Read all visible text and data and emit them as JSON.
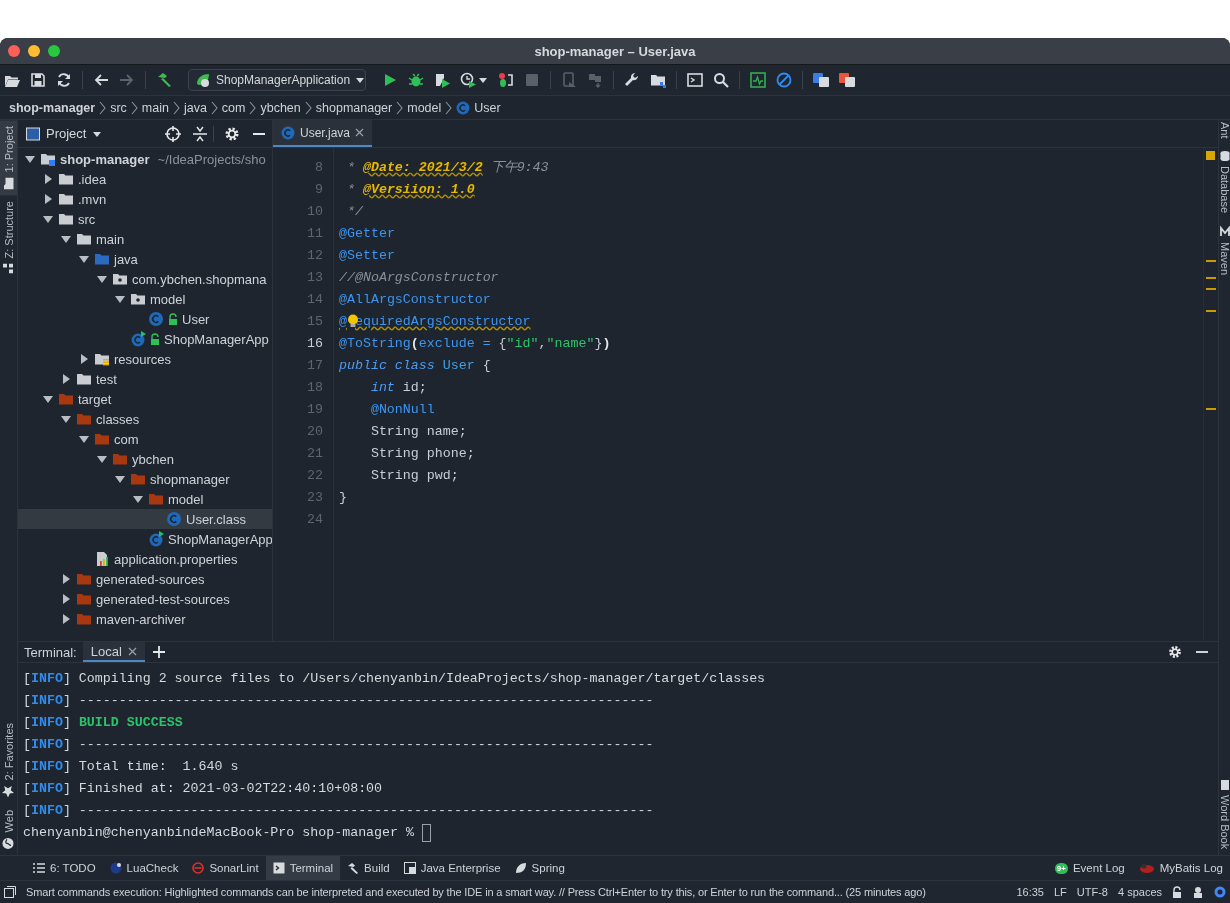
{
  "window": {
    "title": "shop-manager – User.java"
  },
  "toolbar": {
    "run_configuration": "ShopManagerApplication"
  },
  "breadcrumbs": [
    {
      "label": "shop-manager",
      "kind": "project"
    },
    {
      "label": "src",
      "kind": "dir"
    },
    {
      "label": "main",
      "kind": "dir"
    },
    {
      "label": "java",
      "kind": "dir"
    },
    {
      "label": "com",
      "kind": "dir"
    },
    {
      "label": "ybchen",
      "kind": "dir"
    },
    {
      "label": "shopmanager",
      "kind": "dir"
    },
    {
      "label": "model",
      "kind": "dir"
    },
    {
      "label": "User",
      "kind": "class"
    }
  ],
  "left_stripe": {
    "top": [
      {
        "label": "1: Project",
        "kind": "project",
        "selected": true
      },
      {
        "label": "Z: Structure",
        "kind": "structure",
        "selected": false
      }
    ],
    "bottom": [
      {
        "label": "2: Favorites",
        "kind": "favorites",
        "selected": false
      },
      {
        "label": "Web",
        "kind": "web",
        "selected": false
      }
    ]
  },
  "right_stripe": {
    "top": [
      {
        "label": "Ant",
        "kind": "ant"
      },
      {
        "label": "Database",
        "kind": "database"
      },
      {
        "label": "Maven",
        "kind": "maven"
      }
    ],
    "bottom": [
      {
        "label": "Word Book",
        "kind": "book"
      }
    ]
  },
  "project_panel": {
    "title": "Project",
    "tree": [
      {
        "label": "shop-manager",
        "hint": "~/IdeaProjects/sho",
        "kind": "module",
        "expanded": true,
        "selected": false,
        "children": [
          {
            "label": ".idea",
            "kind": "folder",
            "expanded": false,
            "selected": false
          },
          {
            "label": ".mvn",
            "kind": "folder",
            "expanded": false,
            "selected": false
          },
          {
            "label": "src",
            "kind": "folder",
            "expanded": true,
            "selected": false,
            "children": [
              {
                "label": "main",
                "kind": "folder",
                "expanded": true,
                "selected": false,
                "children": [
                  {
                    "label": "java",
                    "kind": "source",
                    "expanded": true,
                    "selected": false,
                    "children": [
                      {
                        "label": "com.ybchen.shopmana",
                        "kind": "package",
                        "expanded": true,
                        "selected": false,
                        "children": [
                          {
                            "label": "model",
                            "kind": "package",
                            "expanded": true,
                            "selected": false,
                            "children": [
                              {
                                "label": "User",
                                "kind": "class",
                                "locked": true,
                                "selected": false
                              }
                            ]
                          },
                          {
                            "label": "ShopManagerApp",
                            "kind": "appclass",
                            "locked": true,
                            "selected": false
                          }
                        ]
                      }
                    ]
                  },
                  {
                    "label": "resources",
                    "kind": "resources",
                    "expanded": false,
                    "selected": false
                  }
                ]
              },
              {
                "label": "test",
                "kind": "folder",
                "expanded": false,
                "selected": false
              }
            ]
          },
          {
            "label": "target",
            "kind": "excluded",
            "expanded": true,
            "selected": false,
            "children": [
              {
                "label": "classes",
                "kind": "excluded",
                "expanded": true,
                "selected": false,
                "children": [
                  {
                    "label": "com",
                    "kind": "excluded",
                    "expanded": true,
                    "selected": false,
                    "children": [
                      {
                        "label": "ybchen",
                        "kind": "excluded",
                        "expanded": true,
                        "selected": false,
                        "children": [
                          {
                            "label": "shopmanager",
                            "kind": "excluded",
                            "expanded": true,
                            "selected": false,
                            "children": [
                              {
                                "label": "model",
                                "kind": "excluded",
                                "expanded": true,
                                "selected": false,
                                "children": [
                                  {
                                    "label": "User.class",
                                    "kind": "class",
                                    "locked": false,
                                    "selected": true
                                  }
                                ]
                              },
                              {
                                "label": "ShopManagerApp",
                                "kind": "appclass",
                                "locked": false,
                                "selected": false
                              }
                            ]
                          }
                        ]
                      }
                    ]
                  },
                  {
                    "label": "application.properties",
                    "kind": "properties",
                    "selected": false
                  }
                ]
              },
              {
                "label": "generated-sources",
                "kind": "excluded",
                "expanded": false,
                "selected": false
              },
              {
                "label": "generated-test-sources",
                "kind": "excluded",
                "expanded": false,
                "selected": false
              },
              {
                "label": "maven-archiver",
                "kind": "excluded",
                "expanded": false,
                "selected": false
              }
            ]
          }
        ]
      }
    ]
  },
  "editor": {
    "tabs": [
      {
        "label": "User.java",
        "selected": true
      }
    ],
    "lines": [
      {
        "number": "8",
        "current": false,
        "bulb": false,
        "tokens": [
          {
            "kind": "comment",
            "text": " * "
          },
          {
            "kind": "doctag",
            "text": "@Date: 2021/3/2"
          },
          {
            "kind": "comment",
            "text": " 下午9:43"
          }
        ]
      },
      {
        "number": "9",
        "current": false,
        "bulb": false,
        "tokens": [
          {
            "kind": "comment",
            "text": " * "
          },
          {
            "kind": "doctag",
            "text": "@Versiion: 1.0"
          }
        ]
      },
      {
        "number": "10",
        "current": false,
        "bulb": false,
        "tokens": [
          {
            "kind": "comment",
            "text": " */"
          }
        ]
      },
      {
        "number": "11",
        "current": false,
        "bulb": false,
        "tokens": [
          {
            "kind": "annotation",
            "text": "@Getter"
          }
        ]
      },
      {
        "number": "12",
        "current": false,
        "bulb": false,
        "tokens": [
          {
            "kind": "annotation",
            "text": "@Setter"
          }
        ]
      },
      {
        "number": "13",
        "current": false,
        "bulb": false,
        "tokens": [
          {
            "kind": "comment",
            "text": "//@NoArgsConstructor"
          }
        ]
      },
      {
        "number": "14",
        "current": false,
        "bulb": false,
        "tokens": [
          {
            "kind": "annotation",
            "text": "@AllArgsConstructor"
          }
        ]
      },
      {
        "number": "15",
        "current": false,
        "bulb": true,
        "tokens": [
          {
            "kind": "annotation-warn",
            "text": "@"
          },
          {
            "kind": "gap"
          },
          {
            "kind": "annotation-warn",
            "text": "equiredArgsConstructor"
          }
        ]
      },
      {
        "number": "16",
        "current": true,
        "bulb": false,
        "tokens": [
          {
            "kind": "annotation",
            "text": "@ToString"
          },
          {
            "kind": "brace",
            "text": "("
          },
          {
            "kind": "param",
            "text": "exclude = "
          },
          {
            "kind": "plain",
            "text": "{"
          },
          {
            "kind": "string",
            "text": "\"id\""
          },
          {
            "kind": "plain",
            "text": ","
          },
          {
            "kind": "string",
            "text": "\"name\""
          },
          {
            "kind": "plain",
            "text": "}"
          },
          {
            "kind": "brace",
            "text": ")"
          }
        ]
      },
      {
        "number": "17",
        "current": false,
        "bulb": false,
        "tokens": [
          {
            "kind": "keyword",
            "text": "public class "
          },
          {
            "kind": "classname",
            "text": "User"
          },
          {
            "kind": "plain",
            "text": " {"
          }
        ]
      },
      {
        "number": "18",
        "current": false,
        "bulb": false,
        "indented": true,
        "tokens": [
          {
            "kind": "keyword",
            "text": "int"
          },
          {
            "kind": "plain",
            "text": " id;"
          }
        ]
      },
      {
        "number": "19",
        "current": false,
        "bulb": false,
        "indented": true,
        "tokens": [
          {
            "kind": "annotation",
            "text": "@NonNull"
          }
        ]
      },
      {
        "number": "20",
        "current": false,
        "bulb": false,
        "indented": true,
        "tokens": [
          {
            "kind": "plain",
            "text": "String name;"
          }
        ]
      },
      {
        "number": "21",
        "current": false,
        "bulb": false,
        "indented": true,
        "tokens": [
          {
            "kind": "plain",
            "text": "String phone;"
          }
        ]
      },
      {
        "number": "22",
        "current": false,
        "bulb": false,
        "indented": true,
        "tokens": [
          {
            "kind": "plain",
            "text": "String pwd;"
          }
        ]
      },
      {
        "number": "23",
        "current": false,
        "bulb": false,
        "tokens": [
          {
            "kind": "plain",
            "text": "}"
          }
        ]
      },
      {
        "number": "24",
        "current": false,
        "bulb": false
      }
    ]
  },
  "terminal": {
    "title": "Terminal:",
    "tabs": [
      {
        "label": "Local",
        "selected": true
      }
    ],
    "lines": [
      [
        {
          "kind": "plain",
          "text": "["
        },
        {
          "kind": "level",
          "text": "INFO"
        },
        {
          "kind": "plain",
          "text": "] Compiling 2 source files to /Users/chenyanbin/IdeaProjects/shop-manager/target/classes"
        }
      ],
      [
        {
          "kind": "plain",
          "text": "["
        },
        {
          "kind": "level",
          "text": "INFO"
        },
        {
          "kind": "plain",
          "text": "] ------------------------------------------------------------------------"
        }
      ],
      [
        {
          "kind": "plain",
          "text": "["
        },
        {
          "kind": "level",
          "text": "INFO"
        },
        {
          "kind": "plain",
          "text": "] "
        },
        {
          "kind": "success",
          "text": "BUILD SUCCESS"
        }
      ],
      [
        {
          "kind": "plain",
          "text": "["
        },
        {
          "kind": "level",
          "text": "INFO"
        },
        {
          "kind": "plain",
          "text": "] ------------------------------------------------------------------------"
        }
      ],
      [
        {
          "kind": "plain",
          "text": "["
        },
        {
          "kind": "level",
          "text": "INFO"
        },
        {
          "kind": "plain",
          "text": "] Total time:  1.640 s"
        }
      ],
      [
        {
          "kind": "plain",
          "text": "["
        },
        {
          "kind": "level",
          "text": "INFO"
        },
        {
          "kind": "plain",
          "text": "] Finished at: 2021-03-02T22:40:10+08:00"
        }
      ],
      [
        {
          "kind": "plain",
          "text": "["
        },
        {
          "kind": "level",
          "text": "INFO"
        },
        {
          "kind": "plain",
          "text": "] ------------------------------------------------------------------------"
        }
      ]
    ],
    "prompt": "chenyanbin@chenyanbindeMacBook-Pro shop-manager %"
  },
  "tool_windows": {
    "left": [
      {
        "label": "6: TODO",
        "kind": "todo",
        "selected": false
      },
      {
        "label": "LuaCheck",
        "kind": "lua",
        "selected": false
      },
      {
        "label": "SonarLint",
        "kind": "sonar",
        "selected": false
      },
      {
        "label": "Terminal",
        "kind": "terminal",
        "selected": true
      },
      {
        "label": "Build",
        "kind": "build",
        "selected": false
      },
      {
        "label": "Java Enterprise",
        "kind": "enterprise",
        "selected": false
      },
      {
        "label": "Spring",
        "kind": "spring",
        "selected": false
      }
    ],
    "right": [
      {
        "label": "Event Log",
        "kind": "event",
        "badge": "9+"
      },
      {
        "label": "MyBatis Log",
        "kind": "mybatis"
      }
    ]
  },
  "status_bar": {
    "message": "Smart commands execution: Highlighted commands can be interpreted and executed by the IDE in a smart way. // Press Ctrl+Enter to try this, or Enter to run the command... (25 minutes ago)",
    "items": [
      "16:35",
      "LF",
      "UTF-8",
      "4 spaces"
    ]
  }
}
